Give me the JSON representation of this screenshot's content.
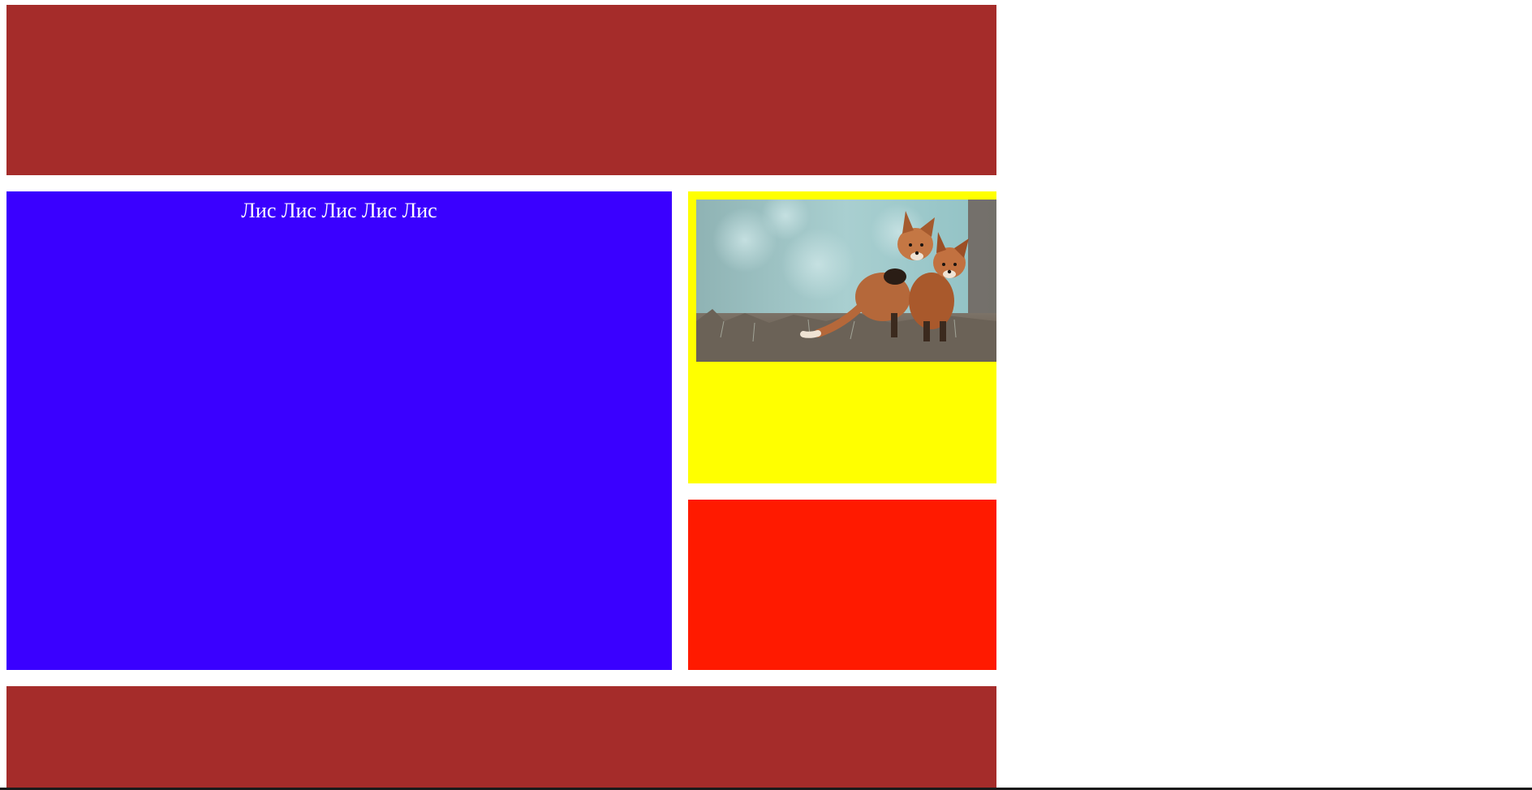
{
  "colors": {
    "header_bg": "#a52c2a",
    "main_bg": "#3a00ff",
    "aside_top_bg": "#ffff00",
    "aside_bottom_bg": "#ff1a00",
    "footer_bg": "#a52c2a",
    "main_text": "#ffffff"
  },
  "main": {
    "text": "Лис Лис Лис Лис Лис"
  },
  "image": {
    "subject": "fox-cubs-photo"
  }
}
